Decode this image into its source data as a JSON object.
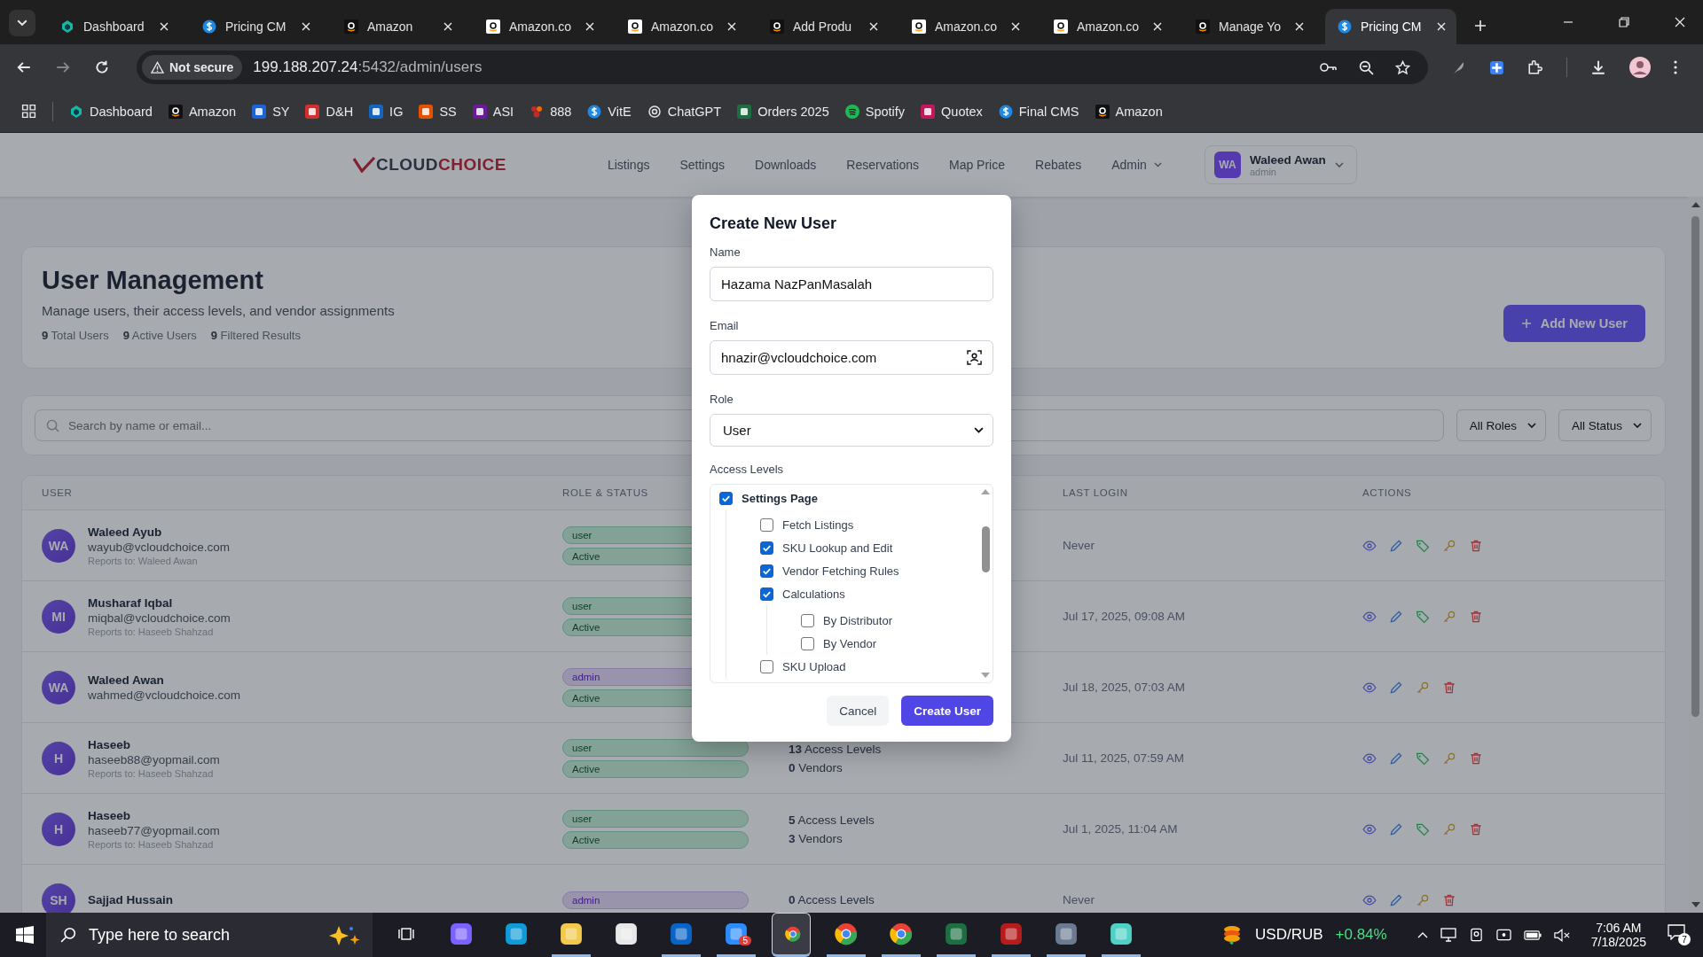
{
  "browser": {
    "tabs": [
      {
        "title": "Dashboard",
        "kind": "cube",
        "selected": false
      },
      {
        "title": "Pricing CM",
        "kind": "dollar",
        "selected": false
      },
      {
        "title": "Amazon",
        "kind": "amazon",
        "selected": false
      },
      {
        "title": "Amazon.co",
        "kind": "amazon-light",
        "selected": false
      },
      {
        "title": "Amazon.co",
        "kind": "amazon-light",
        "selected": false
      },
      {
        "title": "Add Produ",
        "kind": "amazon",
        "selected": false
      },
      {
        "title": "Amazon.co",
        "kind": "amazon-light",
        "selected": false
      },
      {
        "title": "Amazon.co",
        "kind": "amazon-light",
        "selected": false
      },
      {
        "title": "Manage Yo",
        "kind": "amazon",
        "selected": false
      },
      {
        "title": "Pricing CM",
        "kind": "dollar",
        "selected": true
      }
    ],
    "security": "Not secure",
    "url_host": "199.188.207.24",
    "url_rest": ":5432/admin/users",
    "bookmarks": [
      {
        "label": "Dashboard",
        "kind": "cube"
      },
      {
        "label": "Amazon",
        "kind": "amazon"
      },
      {
        "label": "SY",
        "kind": "ec"
      },
      {
        "label": "D&H",
        "kind": "dh"
      },
      {
        "label": "IG",
        "kind": "ig"
      },
      {
        "label": "SS",
        "kind": "ss"
      },
      {
        "label": "ASI",
        "kind": "asi"
      },
      {
        "label": "888",
        "kind": "rings"
      },
      {
        "label": "VitE",
        "kind": "dollar"
      },
      {
        "label": "ChatGPT",
        "kind": "chatgpt"
      },
      {
        "label": "Orders 2025",
        "kind": "excel"
      },
      {
        "label": "Spotify",
        "kind": "spotify"
      },
      {
        "label": "Quotex",
        "kind": "quotex"
      },
      {
        "label": "Final CMS",
        "kind": "dollar"
      },
      {
        "label": "Amazon",
        "kind": "amazon"
      }
    ]
  },
  "header": {
    "logo_dark": "CLOUD",
    "logo_accent": "CHOICE",
    "nav": [
      {
        "label": "Listings",
        "has_menu": false
      },
      {
        "label": "Settings",
        "has_menu": false
      },
      {
        "label": "Downloads",
        "has_menu": false
      },
      {
        "label": "Reservations",
        "has_menu": false
      },
      {
        "label": "Map Price",
        "has_menu": false
      },
      {
        "label": "Rebates",
        "has_menu": false
      },
      {
        "label": "Admin",
        "has_menu": true
      }
    ],
    "user": {
      "initials": "WA",
      "name": "Waleed Awan",
      "role": "admin"
    }
  },
  "page": {
    "title": "User Management",
    "subtitle": "Manage users, their access levels, and vendor assignments",
    "stats": [
      {
        "count": "9",
        "label": "Total Users"
      },
      {
        "count": "9",
        "label": "Active Users"
      },
      {
        "count": "9",
        "label": "Filtered Results"
      }
    ],
    "add_button": "Add New User",
    "search": {
      "placeholder": "Search by name or email..."
    },
    "filters": [
      {
        "value": "All Roles"
      },
      {
        "value": "All Status"
      }
    ]
  },
  "table": {
    "columns": [
      {
        "label": "USER"
      },
      {
        "label": "ROLE & STATUS"
      },
      {
        "label": "LAST LOGIN"
      },
      {
        "label": "ACTIONS"
      }
    ],
    "rows": [
      {
        "initials": "WA",
        "name": "Waleed Ayub",
        "email": "wayub@vcloudchoice.com",
        "reports_to": "Reports to: Waleed Awan",
        "role": {
          "label": "user",
          "kind": "user"
        },
        "status": "Active",
        "last_login": "Never",
        "actions": [
          {
            "kind": "view"
          },
          {
            "kind": "edit"
          },
          {
            "kind": "vendors"
          },
          {
            "kind": "password"
          },
          {
            "kind": "delete"
          }
        ]
      },
      {
        "initials": "MI",
        "name": "Musharaf Iqbal",
        "email": "miqbal@vcloudchoice.com",
        "reports_to": "Reports to: Haseeb Shahzad",
        "role": {
          "label": "user",
          "kind": "user"
        },
        "status": "Active",
        "last_login": "Jul 17, 2025, 09:08 AM",
        "actions": [
          {
            "kind": "view"
          },
          {
            "kind": "edit"
          },
          {
            "kind": "vendors"
          },
          {
            "kind": "password"
          },
          {
            "kind": "delete"
          }
        ]
      },
      {
        "initials": "WA",
        "name": "Waleed Awan",
        "email": "wahmed@vcloudchoice.com",
        "role": {
          "label": "admin",
          "kind": "admin"
        },
        "status": "Active",
        "last_login": "Jul 18, 2025, 07:03 AM",
        "actions": [
          {
            "kind": "view"
          },
          {
            "kind": "edit"
          },
          {
            "kind": "password"
          },
          {
            "kind": "delete"
          }
        ]
      },
      {
        "initials": "H",
        "name": "Haseeb",
        "email": "haseeb88@yopmail.com",
        "reports_to": "Reports to: Haseeb Shahzad",
        "role": {
          "label": "user",
          "kind": "user"
        },
        "status": "Active",
        "access": [
          {
            "count": "13",
            "label": "Access Levels"
          },
          {
            "count": "0",
            "label": "Vendors"
          }
        ],
        "last_login": "Jul 11, 2025, 07:59 AM",
        "actions": [
          {
            "kind": "view"
          },
          {
            "kind": "edit"
          },
          {
            "kind": "vendors"
          },
          {
            "kind": "password"
          },
          {
            "kind": "delete"
          }
        ]
      },
      {
        "initials": "H",
        "name": "Haseeb",
        "email": "haseeb77@yopmail.com",
        "reports_to": "Reports to: Haseeb Shahzad",
        "role": {
          "label": "user",
          "kind": "user"
        },
        "status": "Active",
        "access": [
          {
            "count": "5",
            "label": "Access Levels"
          },
          {
            "count": "3",
            "label": "Vendors"
          }
        ],
        "last_login": "Jul 1, 2025, 11:04 AM",
        "actions": [
          {
            "kind": "view"
          },
          {
            "kind": "edit"
          },
          {
            "kind": "vendors"
          },
          {
            "kind": "password"
          },
          {
            "kind": "delete"
          }
        ]
      },
      {
        "initials": "SH",
        "name": "Sajjad Hussain",
        "role": {
          "label": "admin",
          "kind": "admin"
        },
        "access": [
          {
            "count": "0",
            "label": "Access Levels"
          }
        ],
        "last_login": "Never",
        "actions": [
          {
            "kind": "view"
          },
          {
            "kind": "edit"
          },
          {
            "kind": "password"
          },
          {
            "kind": "delete"
          }
        ]
      }
    ]
  },
  "modal": {
    "title": "Create New User",
    "fields": [
      {
        "label": "Name",
        "value": "Hazama NazPanMasalah",
        "kind": "text"
      },
      {
        "label": "Email",
        "value": "hnazir@vcloudchoice.com",
        "kind": "email"
      },
      {
        "label": "Role",
        "value": "User",
        "kind": "select"
      }
    ],
    "access_levels": {
      "label": "Access Levels",
      "items": [
        {
          "label": "Settings Page",
          "checked": true,
          "children": [
            {
              "label": "Fetch Listings",
              "checked": false
            },
            {
              "label": "SKU Lookup and Edit",
              "checked": true
            },
            {
              "label": "Vendor Fetching Rules",
              "checked": true
            },
            {
              "label": "Calculations",
              "checked": true,
              "children": [
                {
                  "label": "By Distributor",
                  "checked": false
                },
                {
                  "label": "By Vendor",
                  "checked": false
                }
              ]
            },
            {
              "label": "SKU Upload",
              "checked": false
            }
          ]
        }
      ]
    },
    "buttons": [
      {
        "label": "Cancel",
        "kind": "secondary"
      },
      {
        "label": "Create User",
        "kind": "primary"
      }
    ]
  },
  "taskbar": {
    "search_placeholder": "Type here to search",
    "apps": [
      {
        "kind": "taskview",
        "running": false,
        "selected": false
      },
      {
        "kind": "copilot",
        "running": false,
        "selected": false
      },
      {
        "kind": "edge",
        "running": false,
        "selected": false
      },
      {
        "kind": "explorer",
        "running": true,
        "selected": false
      },
      {
        "kind": "store",
        "running": false,
        "selected": false
      },
      {
        "kind": "outlook",
        "running": true,
        "selected": false
      },
      {
        "kind": "zoom",
        "running": true,
        "selected": false,
        "badge": "5"
      },
      {
        "kind": "chrome",
        "running": true,
        "selected": true
      },
      {
        "kind": "chrome",
        "running": true,
        "selected": false
      },
      {
        "kind": "chrome",
        "running": true,
        "selected": false
      },
      {
        "kind": "excel",
        "running": true,
        "selected": false
      },
      {
        "kind": "filezilla",
        "running": true,
        "selected": false
      },
      {
        "kind": "calculator",
        "running": true,
        "selected": false
      },
      {
        "kind": "gem",
        "running": true,
        "selected": false
      }
    ],
    "ticker": {
      "label": "USD/RUB",
      "change": "+0.84%"
    },
    "time": "7:06 AM",
    "date": "7/18/2025",
    "notifications": "7"
  }
}
